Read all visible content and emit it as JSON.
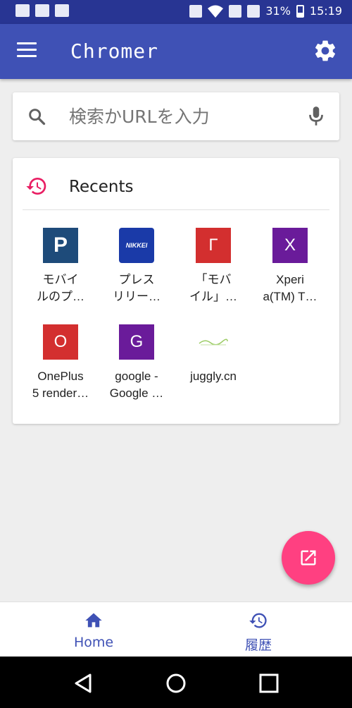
{
  "status_bar": {
    "battery": "31%",
    "time": "15:19"
  },
  "app_bar": {
    "title": "Chromer"
  },
  "search": {
    "placeholder": "検索かURLを入力"
  },
  "recents": {
    "title": "Recents",
    "items": [
      {
        "label": "モバイ\nルのプ…",
        "icon_text": "P",
        "color": "#1e4b7a"
      },
      {
        "label": "プレス\nリリー…",
        "icon_text": "NIKKEI",
        "color": "#1a3aa8"
      },
      {
        "label": "「モバ\nイル」…",
        "icon_text": "Γ",
        "color": "#d32f2f"
      },
      {
        "label": "Xperi\na(TM) T…",
        "icon_text": "X",
        "color": "#6a1b9a"
      },
      {
        "label": "OnePlus\n5 render…",
        "icon_text": "O",
        "color": "#d32f2f"
      },
      {
        "label": "google -\nGoogle …",
        "icon_text": "G",
        "color": "#6a1b9a"
      },
      {
        "label": "juggly.cn",
        "icon_text": "",
        "color": "#ffffff"
      }
    ]
  },
  "bottom_nav": {
    "home": "Home",
    "history": "履歴"
  },
  "colors": {
    "primary": "#3f51b5",
    "primary_dark": "#283593",
    "accent": "#ff4081",
    "recents_icon": "#e91e63"
  }
}
